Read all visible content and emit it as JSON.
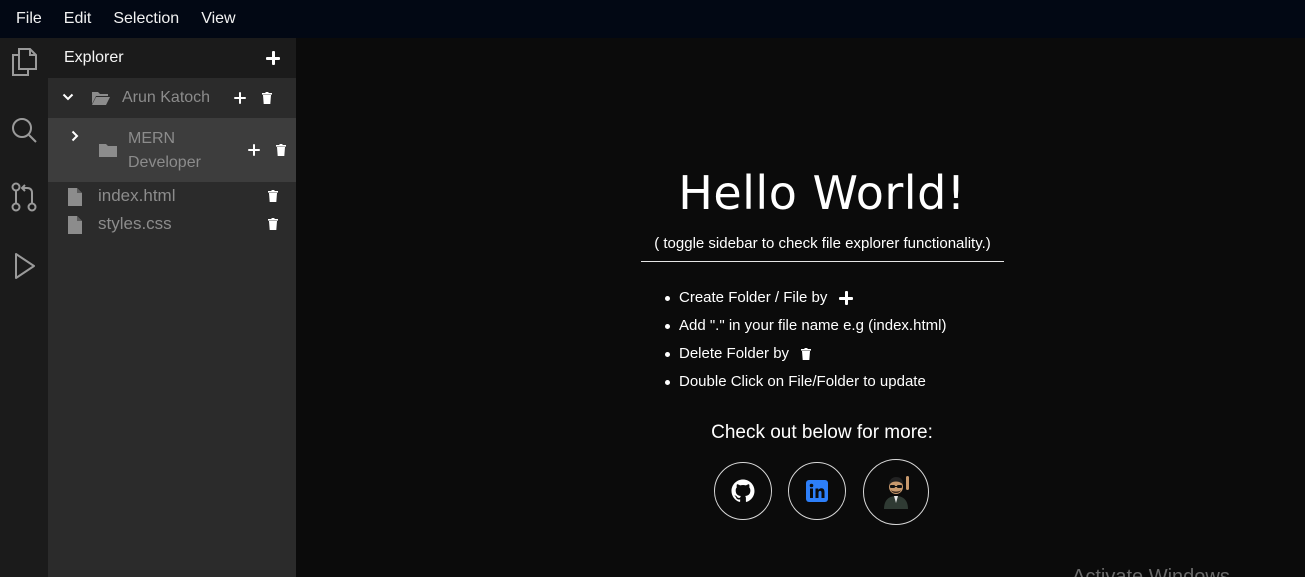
{
  "menu": [
    "File",
    "Edit",
    "Selection",
    "View"
  ],
  "activity_icons": [
    "files-icon",
    "search-icon",
    "source-control-icon",
    "run-icon"
  ],
  "sidebar": {
    "title": "Explorer",
    "root_folder": "Arun Katoch",
    "sub_folder": "MERN Developer",
    "files": [
      "index.html",
      "styles.css"
    ]
  },
  "main": {
    "heading": "Hello World!",
    "subtitle": "( toggle sidebar to check file explorer functionality.)",
    "tips": [
      "Create Folder / File by",
      "Add \".\" in your file name e.g (index.html)",
      "Delete Folder by",
      "Double Click on File/Folder to update"
    ],
    "more_label": "Check out below for more:",
    "social": [
      "github-icon",
      "linkedin-icon",
      "avatar"
    ]
  },
  "watermark": "Activate Windows",
  "colors": {
    "menubar_bg": "#020814",
    "sidebar_bg": "#2b2b2b",
    "selected_row_bg": "#3d3d3d",
    "main_bg": "#0b0b0b",
    "linkedin_blue": "#2d7ff9"
  }
}
